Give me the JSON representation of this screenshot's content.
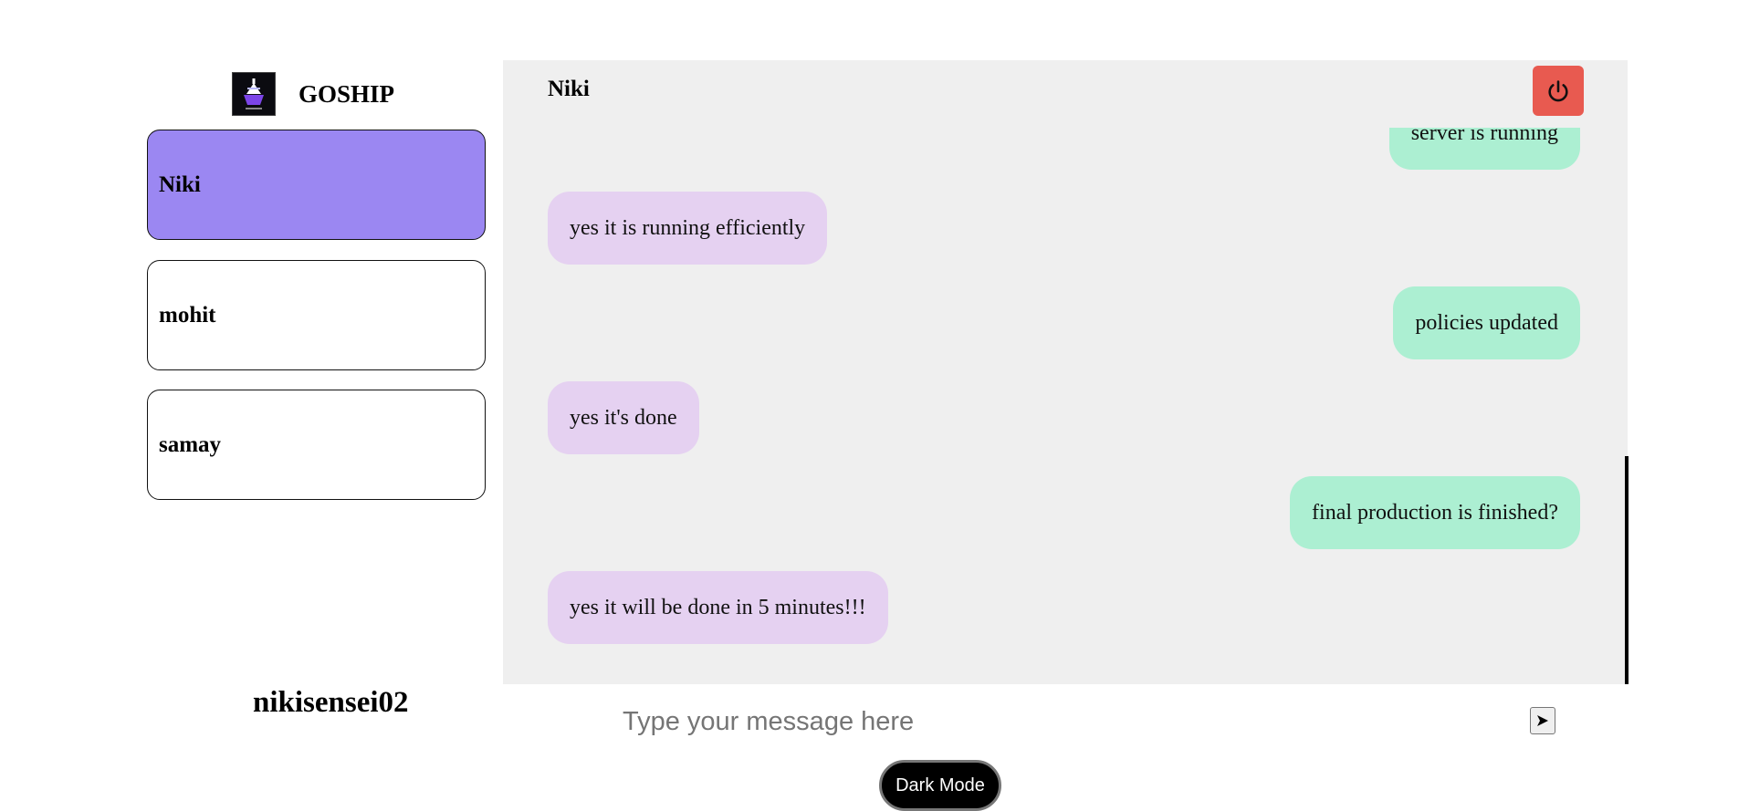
{
  "app": {
    "brand_name": "GOSHIP",
    "logo_icon": "ship-logo-icon"
  },
  "sidebar": {
    "contacts": [
      {
        "label": "Niki",
        "active": true
      },
      {
        "label": "mohit",
        "active": false
      },
      {
        "label": "samay",
        "active": false
      }
    ],
    "username": "nikisensei02"
  },
  "chat": {
    "header_name": "Niki",
    "logout_icon": "power-icon",
    "messages": [
      {
        "from": "me",
        "text": "server is running"
      },
      {
        "from": "them",
        "text": "yes it is running efficiently"
      },
      {
        "from": "me",
        "text": "policies updated"
      },
      {
        "from": "them",
        "text": "yes it's done"
      },
      {
        "from": "me",
        "text": "final production is finished?"
      },
      {
        "from": "them",
        "text": "yes it will be done in 5 minutes!!!"
      }
    ]
  },
  "composer": {
    "placeholder": "Type your message here",
    "value": "",
    "send_icon": "send-arrow-icon"
  },
  "theme": {
    "toggle_label": "Dark Mode"
  },
  "colors": {
    "active_contact": "#9b87f2",
    "sent_bubble": "#acefd2",
    "received_bubble": "#e5d1f1",
    "chat_background": "#efefef",
    "logout_button": "#e85a50"
  }
}
